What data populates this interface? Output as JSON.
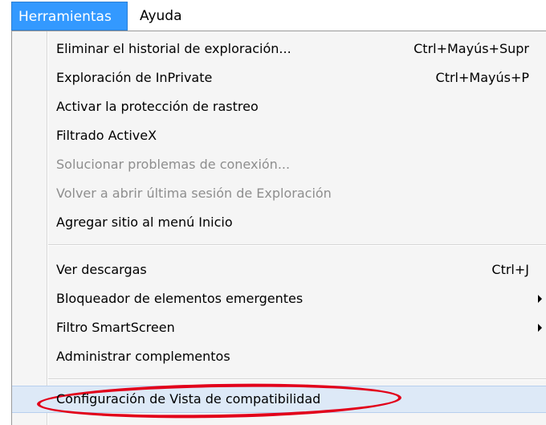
{
  "menubar": {
    "tools_label": "Herramientas",
    "help_label": "Ayuda"
  },
  "menu": {
    "delete_history": {
      "label": "Eliminar el historial de exploración...",
      "shortcut": "Ctrl+Mayús+Supr"
    },
    "inprivate": {
      "label": "Exploración de InPrivate",
      "shortcut": "Ctrl+Mayús+P"
    },
    "tracking_protection": {
      "label": "Activar la protección de rastreo"
    },
    "activex": {
      "label": "Filtrado ActiveX"
    },
    "fix_connection": {
      "label": "Solucionar problemas de conexión...",
      "disabled": true
    },
    "reopen_session": {
      "label": "Volver a abrir última sesión de Exploración",
      "disabled": true
    },
    "add_site_start": {
      "label": "Agregar sitio al menú Inicio"
    },
    "view_downloads": {
      "label": "Ver descargas",
      "shortcut": "Ctrl+J"
    },
    "popup_blocker": {
      "label": "Bloqueador de elementos emergentes",
      "submenu": true
    },
    "smartscreen": {
      "label": "Filtro SmartScreen",
      "submenu": true
    },
    "manage_addons": {
      "label": "Administrar complementos"
    },
    "compat_view": {
      "label": "Configuración de Vista de compatibilidad",
      "highlighted": true
    }
  },
  "colors": {
    "menubar_active": "#3399ff",
    "menu_bg": "#f5f5f5",
    "highlight_bg": "#dde9f7",
    "disabled_text": "#8e8e8e",
    "annotation_ellipse": "#e2001a"
  }
}
